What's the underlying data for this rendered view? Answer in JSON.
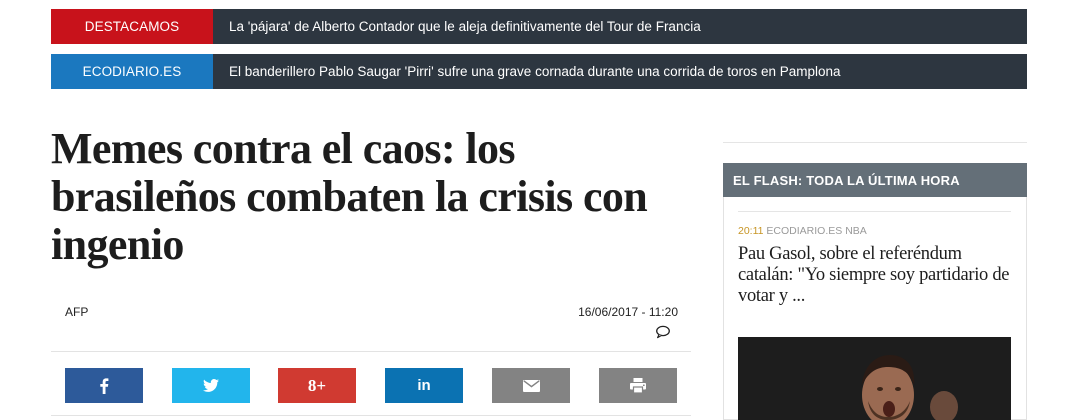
{
  "tickers": [
    {
      "label": "DESTACAMOS",
      "text": "La 'pájara' de Alberto Contador que le aleja definitivamente del Tour de Francia",
      "label_color": "#c8121b"
    },
    {
      "label": "ECODIARIO.ES",
      "text": "El banderillero Pablo Saugar 'Pirri' sufre una grave cornada durante una corrida de toros en Pamplona",
      "label_color": "#1b78bf"
    }
  ],
  "article": {
    "title_lines": [
      "Memes contra el caos: los",
      "brasileños combaten la crisis con",
      "ingenio"
    ],
    "author": "AFP",
    "date": "16/06/2017 - 11:20",
    "share": {
      "facebook": {
        "icon": "facebook-icon",
        "color": "#2d5a9a"
      },
      "twitter": {
        "icon": "twitter-icon",
        "color": "#22b5ec"
      },
      "googleplus": {
        "icon": "google-plus-icon",
        "label": "8+",
        "color": "#d03a31"
      },
      "linkedin": {
        "icon": "linkedin-icon",
        "label": "in",
        "color": "#0b72b2"
      },
      "email": {
        "icon": "mail-icon",
        "color": "#838383"
      },
      "print": {
        "icon": "print-icon",
        "color": "#838383"
      }
    }
  },
  "sidebar": {
    "header": "EL FLASH: TODA LA ÚLTIMA HORA",
    "item": {
      "time": "20:11",
      "source": "ECODIARIO.ES",
      "category": "NBA",
      "title": "Pau Gasol, sobre el referéndum catalán: \"Yo siempre soy partidario de votar y ..."
    }
  }
}
